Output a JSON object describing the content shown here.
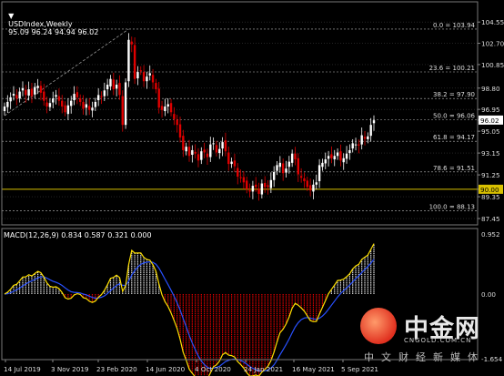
{
  "header": {
    "symbol": "USDIndex,Weekly",
    "ohlc": "95.09 96.24 94.94 96.02"
  },
  "price_axis": {
    "labels": [
      "104.55",
      "102.70",
      "100.85",
      "98.80",
      "96.95",
      "96.02",
      "95.05",
      "93.15",
      "91.25",
      "90.00",
      "89.35",
      "87.45"
    ],
    "current_price": "96.02",
    "hline_price": "90.00"
  },
  "fibonacci": {
    "levels": [
      {
        "label": "0.0 = 103.94",
        "price": 103.94
      },
      {
        "label": "23.6 = 100.21",
        "price": 100.21
      },
      {
        "label": "38.2 = 97.90",
        "price": 97.9
      },
      {
        "label": "50.0 = 96.06",
        "price": 96.06
      },
      {
        "label": "61.8 = 94.17",
        "price": 94.17
      },
      {
        "label": "78.6 = 91.51",
        "price": 91.51
      },
      {
        "label": "100.0 = 88.13",
        "price": 88.13
      }
    ]
  },
  "macd": {
    "label": "MACD(12,26,9) 0.834 0.587 0.321 0.000",
    "axis_labels": [
      "0.952",
      "0.00",
      "-1.654"
    ]
  },
  "time_axis": {
    "labels": [
      "14 Jul 2019",
      "3 Nov 2019",
      "23 Feb 2020",
      "14 Jun 2020",
      "4 Oct 2020",
      "24 Jan 2021",
      "16 May 2021",
      "5 Sep 2021"
    ]
  },
  "watermark": {
    "brand": "中金网",
    "domain": "CNGOLD.COM.CN",
    "tagline": "中文财经新媒体"
  },
  "colors": {
    "up": "#ffffff",
    "down": "#e00000",
    "hline": "#d8c000",
    "macd_line": "#ffe000",
    "signal_line": "#2850ff",
    "grid": "#3a3a3a"
  },
  "chart_data": {
    "type": "candlestick",
    "title": "USDIndex,Weekly",
    "ylim": [
      86.9,
      105.2
    ],
    "close_approx": [
      97.2,
      97.6,
      98.0,
      98.3,
      97.9,
      98.5,
      98.8,
      98.2,
      98.7,
      98.1,
      98.9,
      99.0,
      98.4,
      97.7,
      97.2,
      97.5,
      97.9,
      98.2,
      97.7,
      97.2,
      96.7,
      97.3,
      97.7,
      98.3,
      98.0,
      97.6,
      97.0,
      97.4,
      96.9,
      97.1,
      97.6,
      98.2,
      98.1,
      98.6,
      99.1,
      99.6,
      98.7,
      99.1,
      98.2,
      95.6,
      99.3,
      103.0,
      102.6,
      99.6,
      100.2,
      100.3,
      99.4,
      99.8,
      100.1,
      99.3,
      98.7,
      97.1,
      96.9,
      97.2,
      97.4,
      96.7,
      96.1,
      95.6,
      94.5,
      93.4,
      93.7,
      92.9,
      93.4,
      93.1,
      92.5,
      93.3,
      93.2,
      92.8,
      93.9,
      94.0,
      93.2,
      93.5,
      94.1,
      93.3,
      92.2,
      92.4,
      92.0,
      91.1,
      91.0,
      90.6,
      90.0,
      89.8,
      90.3,
      90.2,
      89.6,
      90.5,
      90.2,
      90.2,
      90.8,
      91.5,
      92.1,
      92.3,
      91.4,
      91.8,
      92.4,
      93.1,
      92.6,
      91.3,
      91.0,
      90.7,
      90.2,
      89.9,
      90.4,
      90.6,
      92.1,
      92.3,
      92.6,
      92.9,
      92.7,
      92.9,
      93.2,
      92.5,
      92.7,
      93.1,
      93.4,
      94.0,
      93.9,
      93.8,
      94.7,
      94.4,
      94.6,
      95.6,
      96.0
    ]
  }
}
